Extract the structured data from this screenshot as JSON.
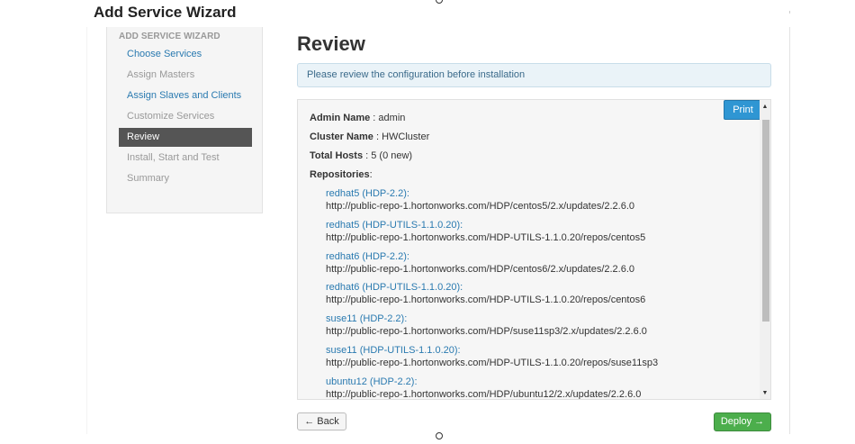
{
  "header": {
    "title": "Add Service Wizard"
  },
  "sidebar": {
    "header": "ADD SERVICE WIZARD",
    "items": [
      {
        "label": "Choose Services",
        "state": "link"
      },
      {
        "label": "Assign Masters",
        "state": "disabled"
      },
      {
        "label": "Assign Slaves and Clients",
        "state": "link"
      },
      {
        "label": "Customize Services",
        "state": "disabled"
      },
      {
        "label": "Review",
        "state": "active"
      },
      {
        "label": "Install, Start and Test",
        "state": "disabled"
      },
      {
        "label": "Summary",
        "state": "disabled"
      }
    ]
  },
  "main": {
    "title": "Review",
    "alert": "Please review the configuration before installation",
    "print_label": "Print",
    "fields": [
      {
        "label": "Admin Name",
        "value": " : admin"
      },
      {
        "label": "Cluster Name",
        "value": " : HWCluster"
      },
      {
        "label": "Total Hosts",
        "value": " : 5 (0 new)"
      },
      {
        "label": "Repositories",
        "value": ":"
      }
    ],
    "repositories": [
      {
        "name": "redhat5 (HDP-2.2):",
        "url": "http://public-repo-1.hortonworks.com/HDP/centos5/2.x/updates/2.2.6.0"
      },
      {
        "name": "redhat5 (HDP-UTILS-1.1.0.20):",
        "url": "http://public-repo-1.hortonworks.com/HDP-UTILS-1.1.0.20/repos/centos5"
      },
      {
        "name": "redhat6 (HDP-2.2):",
        "url": "http://public-repo-1.hortonworks.com/HDP/centos6/2.x/updates/2.2.6.0"
      },
      {
        "name": "redhat6 (HDP-UTILS-1.1.0.20):",
        "url": "http://public-repo-1.hortonworks.com/HDP-UTILS-1.1.0.20/repos/centos6"
      },
      {
        "name": "suse11 (HDP-2.2):",
        "url": "http://public-repo-1.hortonworks.com/HDP/suse11sp3/2.x/updates/2.2.6.0"
      },
      {
        "name": "suse11 (HDP-UTILS-1.1.0.20):",
        "url": "http://public-repo-1.hortonworks.com/HDP-UTILS-1.1.0.20/repos/suse11sp3"
      },
      {
        "name": "ubuntu12 (HDP-2.2):",
        "url": "http://public-repo-1.hortonworks.com/HDP/ubuntu12/2.x/updates/2.2.6.0"
      }
    ]
  },
  "footer": {
    "back_label": "← Back",
    "deploy_label": "Deploy →"
  },
  "icons": {
    "scroll_up": "▲",
    "scroll_down": "▼"
  },
  "colors": {
    "link": "#2a7ab0",
    "active_step": "#555555",
    "print_button": "#2f96d3",
    "deploy_button": "#4cae4c"
  }
}
